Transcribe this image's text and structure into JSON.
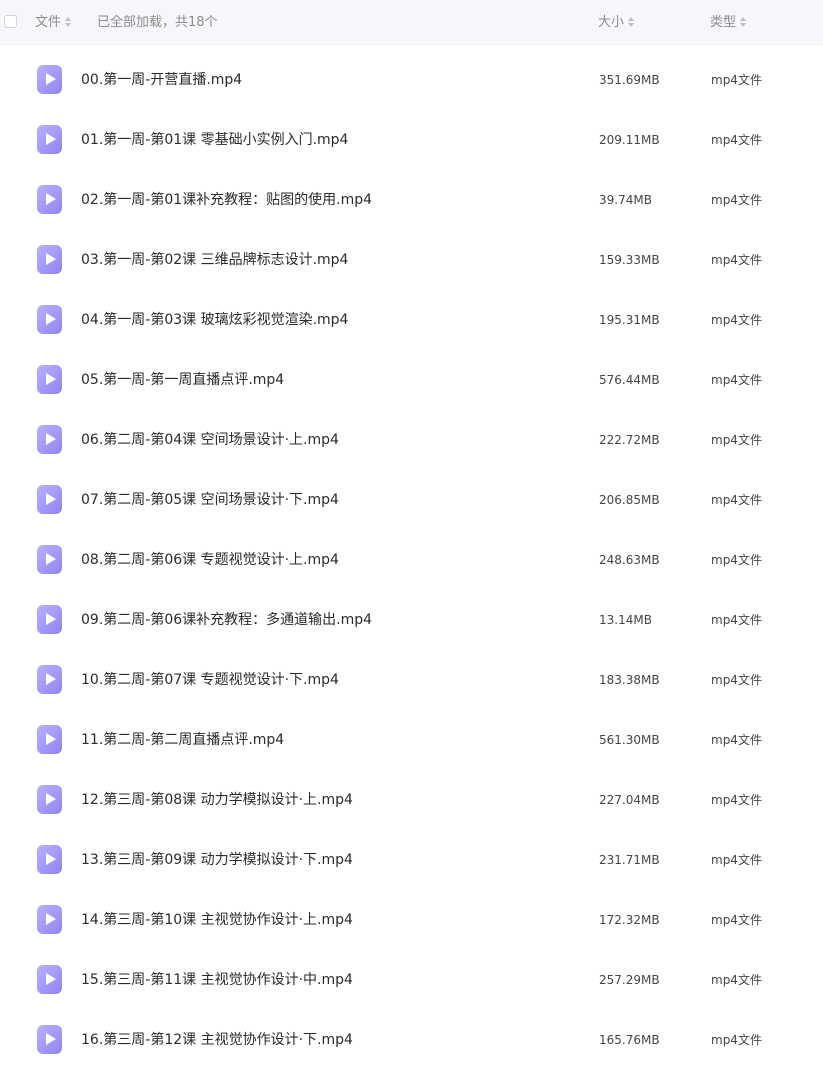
{
  "header": {
    "file_label": "文件",
    "loaded_status": "已全部加载，共18个",
    "size_label": "大小",
    "type_label": "类型"
  },
  "files": [
    {
      "name": "00.第一周-开营直播.mp4",
      "size": "351.69MB",
      "type": "mp4文件"
    },
    {
      "name": "01.第一周-第01课 零基础小实例入门.mp4",
      "size": "209.11MB",
      "type": "mp4文件"
    },
    {
      "name": "02.第一周-第01课补充教程：贴图的使用.mp4",
      "size": "39.74MB",
      "type": "mp4文件"
    },
    {
      "name": "03.第一周-第02课 三维品牌标志设计.mp4",
      "size": "159.33MB",
      "type": "mp4文件"
    },
    {
      "name": "04.第一周-第03课 玻璃炫彩视觉渲染.mp4",
      "size": "195.31MB",
      "type": "mp4文件"
    },
    {
      "name": "05.第一周-第一周直播点评.mp4",
      "size": "576.44MB",
      "type": "mp4文件"
    },
    {
      "name": "06.第二周-第04课 空间场景设计·上.mp4",
      "size": "222.72MB",
      "type": "mp4文件"
    },
    {
      "name": "07.第二周-第05课 空间场景设计·下.mp4",
      "size": "206.85MB",
      "type": "mp4文件"
    },
    {
      "name": "08.第二周-第06课 专题视觉设计·上.mp4",
      "size": "248.63MB",
      "type": "mp4文件"
    },
    {
      "name": "09.第二周-第06课补充教程：多通道输出.mp4",
      "size": "13.14MB",
      "type": "mp4文件"
    },
    {
      "name": "10.第二周-第07课 专题视觉设计·下.mp4",
      "size": "183.38MB",
      "type": "mp4文件"
    },
    {
      "name": "11.第二周-第二周直播点评.mp4",
      "size": "561.30MB",
      "type": "mp4文件"
    },
    {
      "name": "12.第三周-第08课 动力学模拟设计·上.mp4",
      "size": "227.04MB",
      "type": "mp4文件"
    },
    {
      "name": "13.第三周-第09课 动力学模拟设计·下.mp4",
      "size": "231.71MB",
      "type": "mp4文件"
    },
    {
      "name": "14.第三周-第10课 主视觉协作设计·上.mp4",
      "size": "172.32MB",
      "type": "mp4文件"
    },
    {
      "name": "15.第三周-第11课 主视觉协作设计·中.mp4",
      "size": "257.29MB",
      "type": "mp4文件"
    },
    {
      "name": "16.第三周-第12课 主视觉协作设计·下.mp4",
      "size": "165.76MB",
      "type": "mp4文件"
    }
  ]
}
